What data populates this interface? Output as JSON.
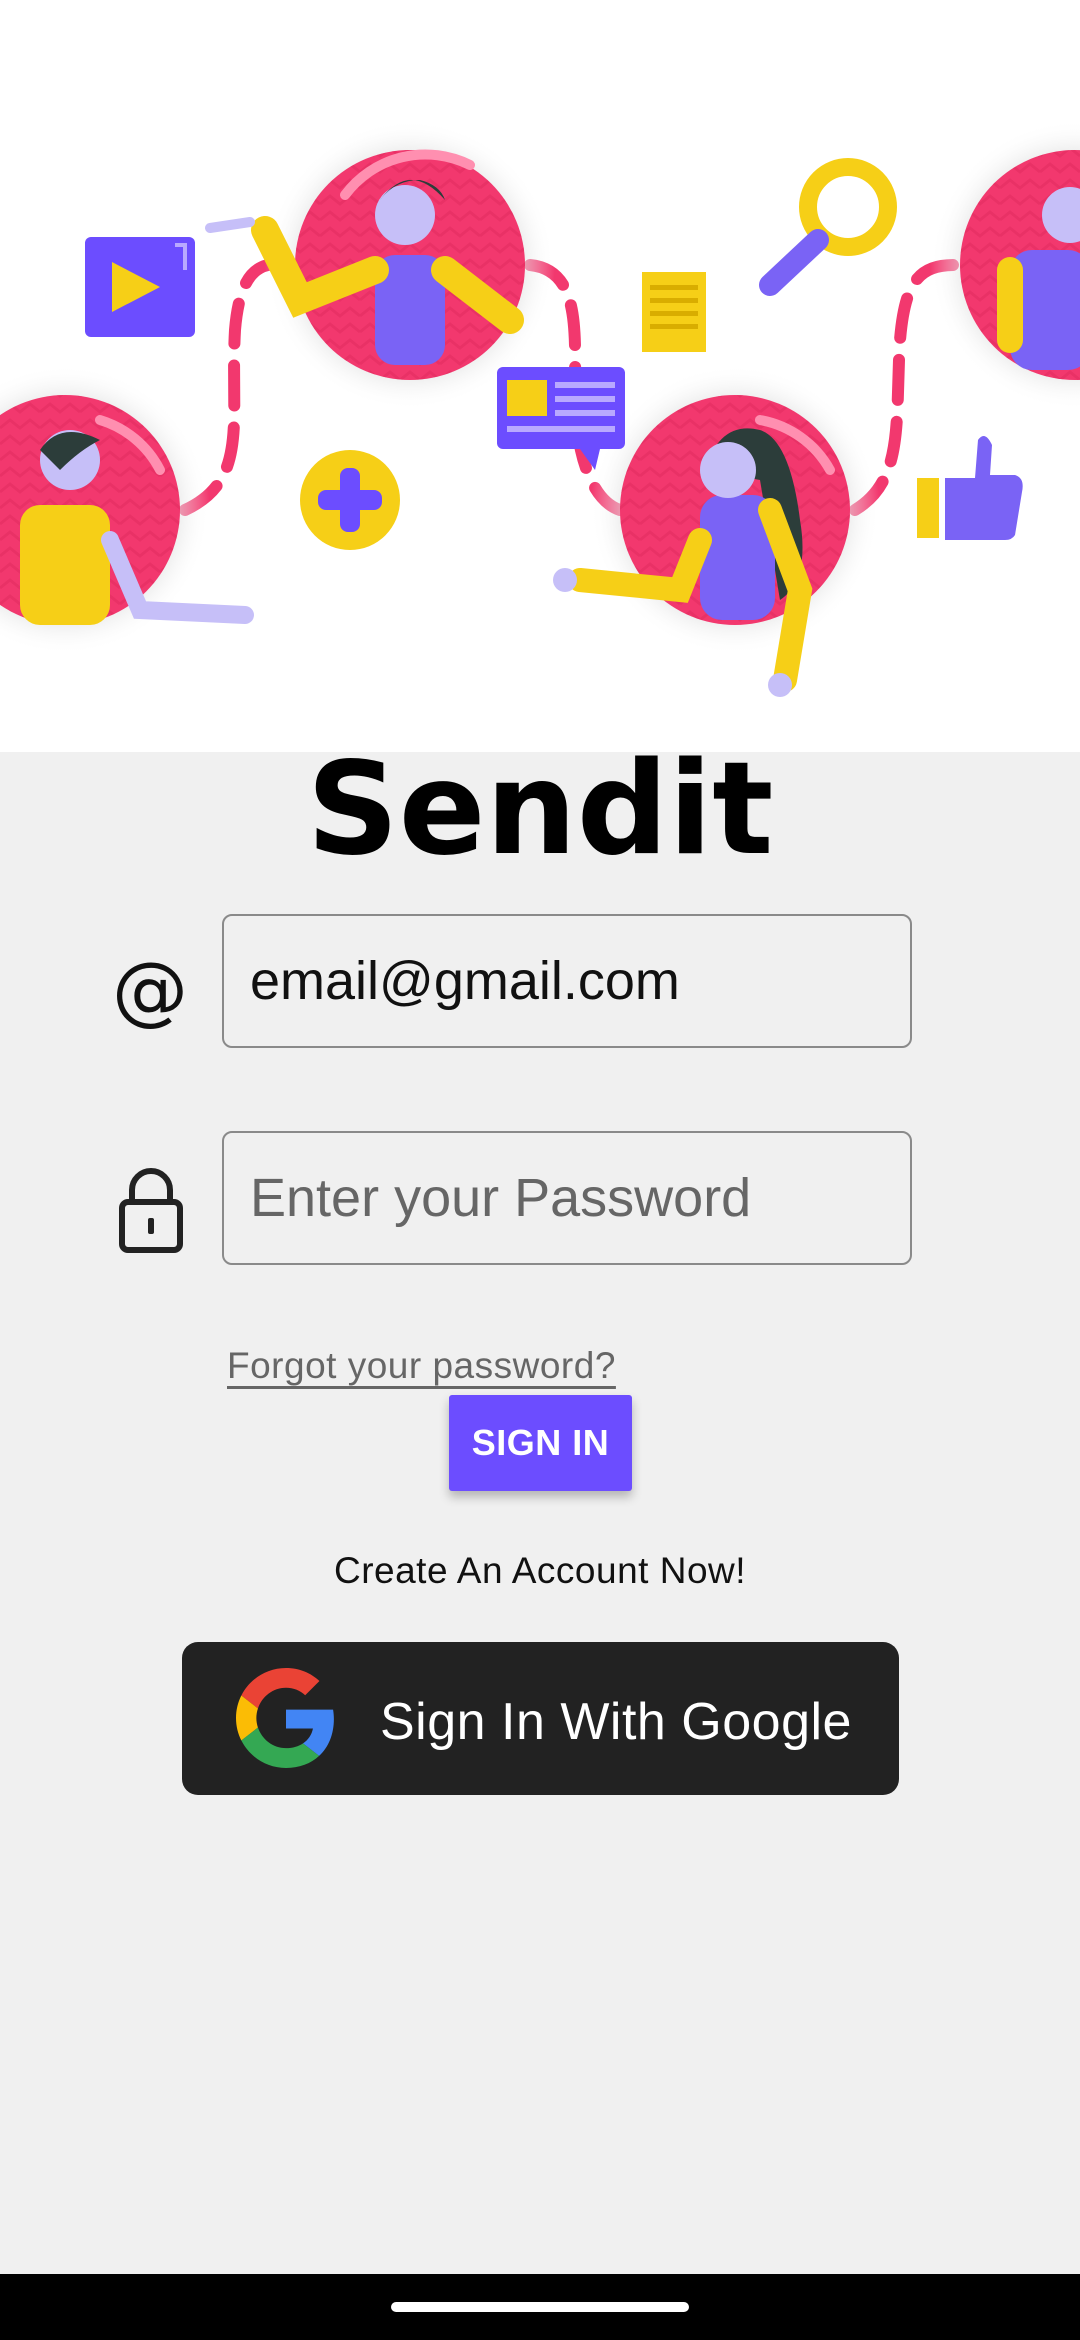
{
  "app": {
    "title": "Sendit"
  },
  "login": {
    "email_icon": "at-icon",
    "email_value": "email@gmail.com",
    "password_icon": "lock-icon",
    "password_placeholder": "Enter your Password",
    "forgot_password": "Forgot your password?",
    "sign_in_label": "SIGN IN",
    "create_account": "Create An Account Now!",
    "google_label": "Sign In With Google",
    "google_icon": "google-logo-icon"
  },
  "colors": {
    "primary": "#6c4dff",
    "pink": "#f2386e",
    "yellow": "#f6cf17",
    "google_button": "#222222",
    "background": "#f0f0f0"
  }
}
